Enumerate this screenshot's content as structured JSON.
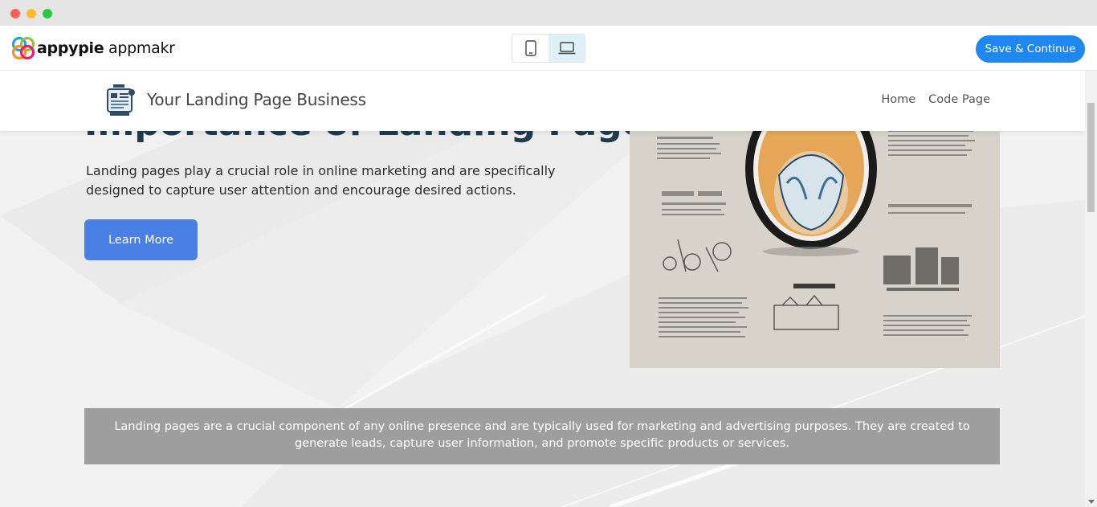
{
  "app": {
    "brand_bold": "appypie",
    "brand_light": " appmakr",
    "save_label": "Save & Continue",
    "device_modes": [
      "mobile",
      "desktop"
    ],
    "active_device": "desktop"
  },
  "site": {
    "title": "Your Landing Page Business",
    "nav": [
      "Home",
      "Code Page"
    ],
    "hero_heading": "Importance of Landing Pages",
    "hero_text": "Landing pages play a crucial role in online marketing and are specifically designed to capture user attention and encourage desired actions.",
    "cta_label": "Learn More",
    "info_text": "Landing pages are a crucial component of any online presence and are typically used for marketing and advertising purposes. They are created to generate leads, capture user information, and promote specific products or services."
  },
  "colors": {
    "accent": "#1e88f0",
    "cta": "#4a80e4",
    "band": "#9e9e9e"
  }
}
